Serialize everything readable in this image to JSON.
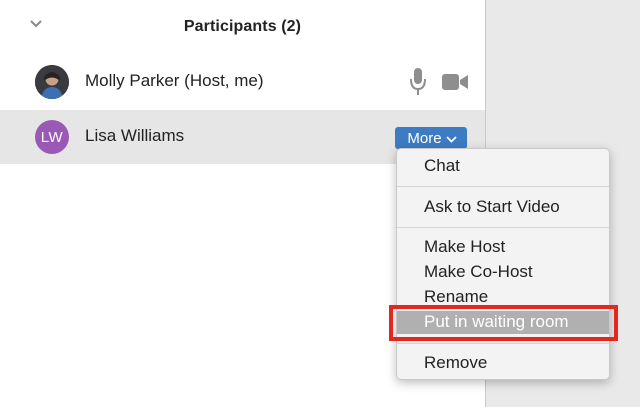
{
  "panel": {
    "title": "Participants (2)"
  },
  "icons": {
    "collapse": "chevron-down-icon",
    "mic": "microphone-icon",
    "video": "video-camera-icon"
  },
  "participants": [
    {
      "name": "Molly Parker (Host, me)",
      "avatar": "photo"
    },
    {
      "name": "Lisa Williams",
      "avatar_initials": "LW",
      "avatar_color": "#9b59b6"
    }
  ],
  "more_button": {
    "label": "More",
    "color": "#3d7bc2"
  },
  "menu": {
    "items": [
      "Chat",
      "Ask to Start Video",
      "Make Host",
      "Make Co-Host",
      "Rename",
      "Put in waiting room",
      "Remove"
    ],
    "highlighted": "Put in waiting room"
  },
  "colors": {
    "highlight_box": "#e2281e",
    "selected_row": "#e6e6e6"
  }
}
